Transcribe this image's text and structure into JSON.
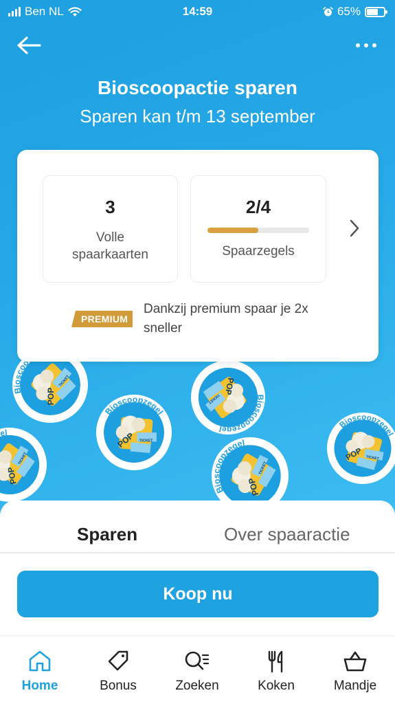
{
  "status_bar": {
    "carrier": "Ben NL",
    "time": "14:59",
    "battery": "65%"
  },
  "header": {
    "back_icon": "arrow-left-icon",
    "more_icon": "more-dots-icon",
    "title": "Bioscoopactie sparen",
    "subtitle": "Sparen kan t/m 13 september"
  },
  "summary": {
    "full_cards_value": "3",
    "full_cards_label": "Volle spaarkaarten",
    "stamps_value": "2/4",
    "stamps_label": "Spaarzegels",
    "stamps_progress": 0.5,
    "premium_badge": "PREMIUM",
    "premium_text": "Dankzij premium spaar je 2x sneller",
    "accent_color": "#d9a142"
  },
  "sticker": {
    "ring_text": "Bioscoopzegel",
    "pop_text": "POP",
    "ticket_text": "TICKET"
  },
  "tabs": {
    "active": "Sparen",
    "other": "Over spaaractie"
  },
  "buy_button": {
    "label": "Koop nu",
    "color": "#1ea2e0"
  },
  "nav": {
    "home": "Home",
    "bonus": "Bonus",
    "search": "Zoeken",
    "cook": "Koken",
    "basket": "Mandje"
  }
}
